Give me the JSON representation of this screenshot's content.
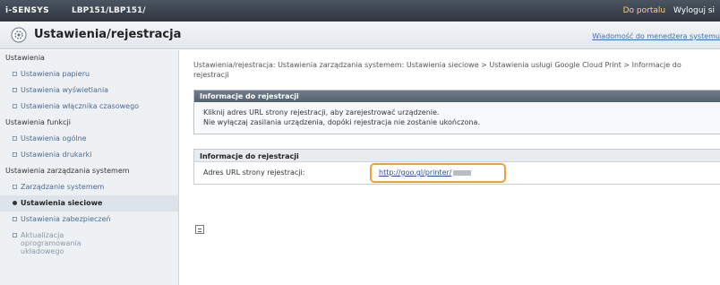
{
  "topbar": {
    "brand": "i-SENSYS",
    "model": "LBP151/LBP151/",
    "portal_link": "Do portalu",
    "logout_link": "Wyloguj si"
  },
  "titlebar": {
    "title": "Ustawienia/rejestracja",
    "message_link": "Wiadomość do menedżera systemu",
    "icon": "settings-gear-icon"
  },
  "sidebar": {
    "groups": [
      {
        "label": "Ustawienia",
        "items": [
          "Ustawienia papieru",
          "Ustawienia wyświetlania",
          "Ustawienia włącznika czasowego"
        ]
      },
      {
        "label": "Ustawienia funkcji",
        "items": [
          "Ustawienia ogólne",
          "Ustawienia drukarki"
        ]
      },
      {
        "label": "Ustawienia zarządzania systemem",
        "items": [
          "Zarządzanie systemem",
          "Ustawienia sieciowe",
          "Ustawienia zabezpieczeń",
          "Aktualizacja oprogramowania układowego"
        ]
      }
    ],
    "active_item": "Ustawienia sieciowe"
  },
  "main": {
    "breadcrumb": "Ustawienia/rejestracja: Ustawienia zarządzania systemem: Ustawienia sieciowe > Ustawienia usługi Google Cloud Print > Informacje do rejestracji",
    "info_panel": {
      "header": "Informacje do rejestracji",
      "line1": "Kliknij adres URL strony rejestracji, aby zarejestrować urządzenie.",
      "line2": "Nie wyłączaj zasilania urządzenia, dopóki rejestracja nie zostanie ukończona."
    },
    "registration_panel": {
      "header": "Informacje do rejestracji",
      "url_label": "Adres URL strony rejestracji:",
      "url_value": "http://goo.gl/printer/"
    }
  },
  "colors": {
    "highlight": "#f0a032",
    "link": "#2a4f9a",
    "topbar": "#2e3640"
  }
}
